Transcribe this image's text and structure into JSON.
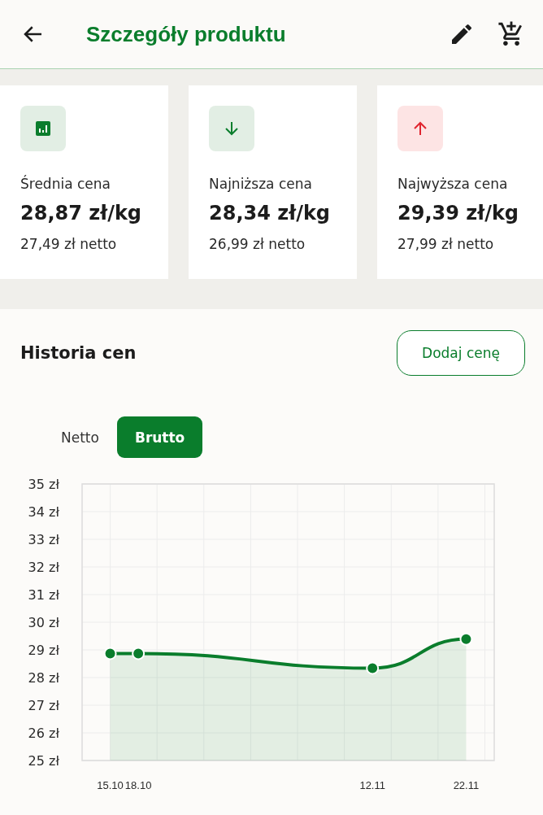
{
  "header": {
    "title": "Szczegóły produktu"
  },
  "stats": [
    {
      "kind": "average",
      "label": "Średnia cena",
      "value": "28,87 zł/kg",
      "net": "27,49 zł netto"
    },
    {
      "kind": "lowest",
      "label": "Najniższa cena",
      "value": "28,34 zł/kg",
      "net": "26,99 zł netto"
    },
    {
      "kind": "highest",
      "label": "Najwyższa cena",
      "value": "29,39 zł/kg",
      "net": "27,99 zł netto"
    }
  ],
  "history": {
    "title": "Historia cen",
    "add_button": "Dodaj cenę",
    "modes": [
      {
        "label": "Netto",
        "selected": false
      },
      {
        "label": "Brutto",
        "selected": true
      }
    ],
    "chart_data": {
      "type": "area",
      "x": [
        "15.10",
        "18.10",
        "12.11",
        "22.11"
      ],
      "series": [
        {
          "color": "#0a7d2c",
          "values": [
            28.87,
            28.87,
            28.34,
            29.39
          ]
        }
      ],
      "ylim": [
        25,
        35
      ],
      "grid": true,
      "yticks": [
        {
          "value": 35,
          "label": "35 zł"
        },
        {
          "value": 34,
          "label": "34 zł"
        },
        {
          "value": 33,
          "label": "33 zł"
        },
        {
          "value": 32,
          "label": "32 zł"
        },
        {
          "value": 31,
          "label": "31 zł"
        },
        {
          "value": 30,
          "label": "30 zł"
        },
        {
          "value": 29,
          "label": "29 zł"
        },
        {
          "value": 28,
          "label": "28 zł"
        },
        {
          "value": 27,
          "label": "27 zł"
        },
        {
          "value": 26,
          "label": "26 zł"
        },
        {
          "value": 25,
          "label": "25 zł"
        }
      ]
    }
  }
}
